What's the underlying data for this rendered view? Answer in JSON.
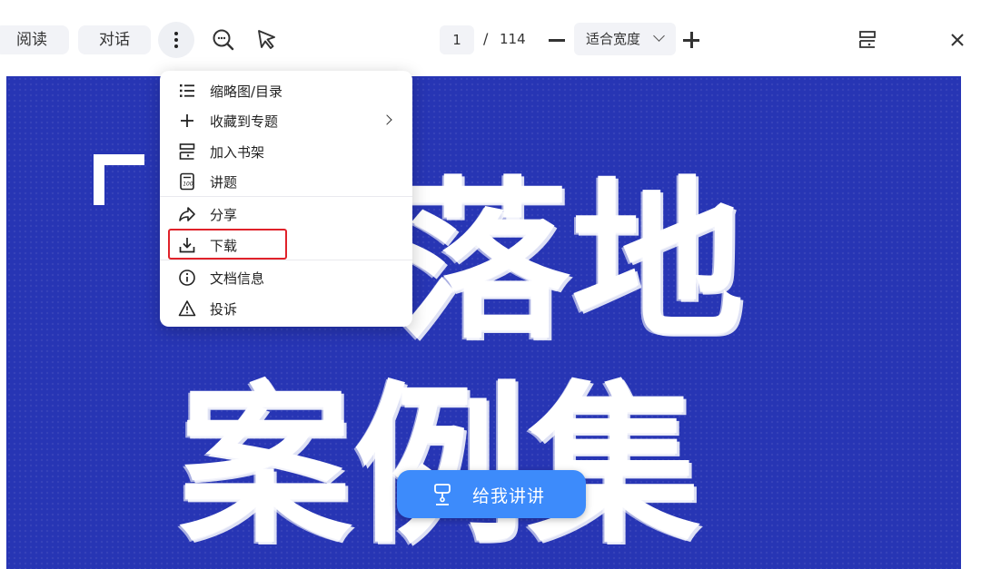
{
  "toolbar": {
    "read_label": "阅读",
    "chat_label": "对话",
    "current_page": "1",
    "page_separator": "/",
    "total_pages": "114",
    "zoom_mode": "适合宽度"
  },
  "menu": {
    "items": [
      {
        "label": "缩略图/目录",
        "icon": "list-icon"
      },
      {
        "label": "收藏到专题",
        "icon": "plus-icon"
      },
      {
        "label": "加入书架",
        "icon": "bookshelf-icon"
      },
      {
        "label": "讲题",
        "icon": "lecture-icon"
      },
      {
        "label": "分享",
        "icon": "share-icon"
      },
      {
        "label": "下载",
        "icon": "download-icon"
      },
      {
        "label": "文档信息",
        "icon": "info-icon"
      },
      {
        "label": "投诉",
        "icon": "warning-icon"
      }
    ]
  },
  "document": {
    "line1": "落地",
    "line2": "案例集"
  },
  "explain_button": {
    "label": "给我讲讲",
    "color": "#3d8bfb"
  },
  "colors": {
    "page_background": "#2735b4",
    "highlight": "#e0222a"
  }
}
